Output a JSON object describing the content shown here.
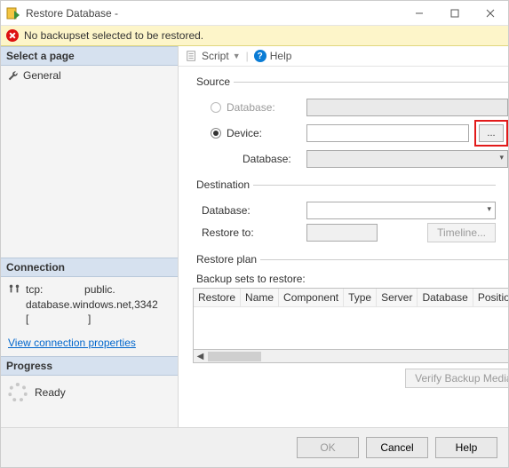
{
  "window": {
    "title": "Restore Database -"
  },
  "error": {
    "message": "No backupset selected to be restored."
  },
  "pages": {
    "header": "Select a page",
    "general": "General"
  },
  "connection": {
    "header": "Connection",
    "line1_prefix": "tcp:",
    "line1_suffix": "public.",
    "line2": "database.windows.net,3342",
    "line3": "[                    ]",
    "link": "View connection properties"
  },
  "progress": {
    "header": "Progress",
    "status": "Ready"
  },
  "toolbar": {
    "script": "Script",
    "help": "Help"
  },
  "source": {
    "legend": "Source",
    "database_label": "Database:",
    "device_label": "Device:",
    "device_value": "",
    "browse": "...",
    "db2_label": "Database:"
  },
  "destination": {
    "legend": "Destination",
    "database_label": "Database:",
    "restoreto_label": "Restore to:",
    "restoreto_value": "",
    "timeline": "Timeline..."
  },
  "plan": {
    "legend": "Restore plan",
    "sets_label": "Backup sets to restore:",
    "columns": [
      "Restore",
      "Name",
      "Component",
      "Type",
      "Server",
      "Database",
      "Position"
    ],
    "verify": "Verify Backup Media"
  },
  "footer": {
    "ok": "OK",
    "cancel": "Cancel",
    "help": "Help"
  }
}
